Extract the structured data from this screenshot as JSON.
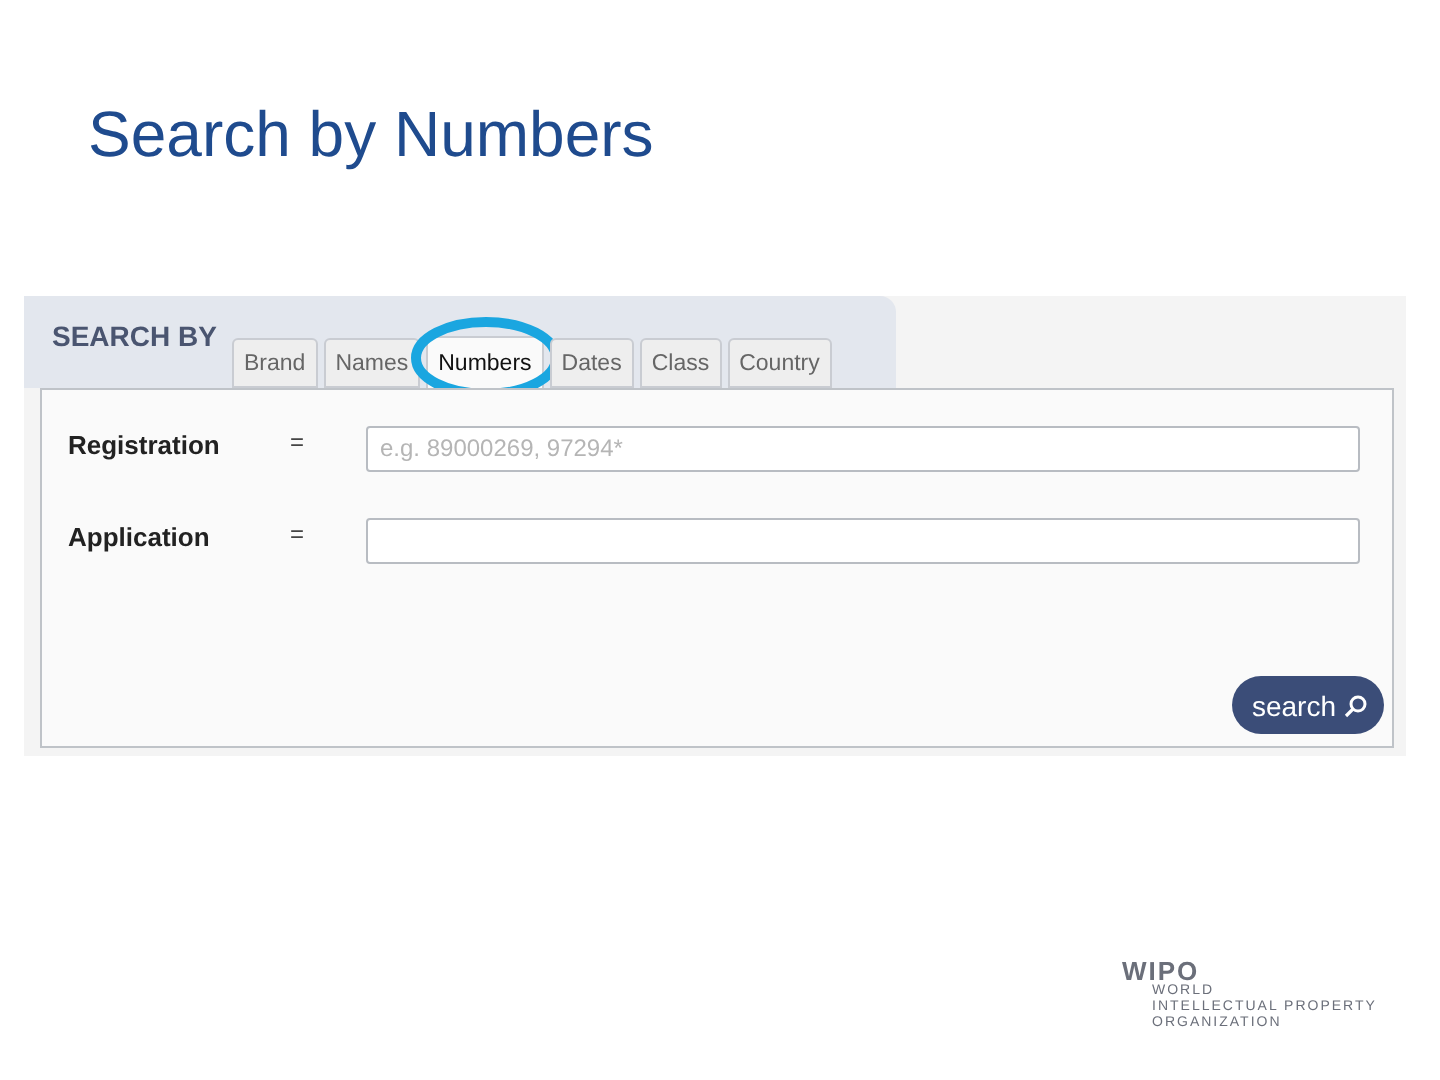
{
  "slide": {
    "title": "Search by Numbers"
  },
  "search_panel": {
    "heading": "SEARCH BY",
    "tabs": [
      {
        "label": "Brand",
        "selected": false,
        "highlighted": false
      },
      {
        "label": "Names",
        "selected": false,
        "highlighted": false
      },
      {
        "label": "Numbers",
        "selected": true,
        "highlighted": true
      },
      {
        "label": "Dates",
        "selected": false,
        "highlighted": false
      },
      {
        "label": "Class",
        "selected": false,
        "highlighted": false
      },
      {
        "label": "Country",
        "selected": false,
        "highlighted": false
      }
    ],
    "fields": [
      {
        "label": "Registration",
        "operator": "=",
        "placeholder": "e.g. 89000269, 97294*"
      },
      {
        "label": "Application",
        "operator": "="
      }
    ],
    "search_button": "search"
  },
  "logo": {
    "name": "WIPO",
    "lines": [
      "WORLD",
      "INTELLECTUAL PROPERTY",
      "ORGANIZATION"
    ]
  }
}
